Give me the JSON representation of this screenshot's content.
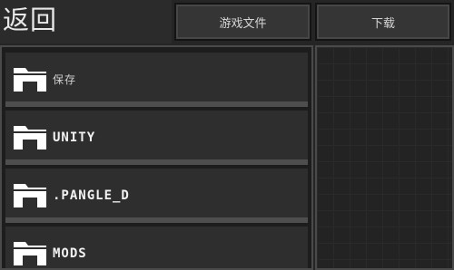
{
  "header": {
    "back_label": "返回",
    "tabs": [
      {
        "label": "游戏文件"
      },
      {
        "label": "下载"
      }
    ]
  },
  "folders": [
    {
      "label": "保存"
    },
    {
      "label": "UNITY"
    },
    {
      "label": ".PANGLE_D"
    },
    {
      "label": "MODS"
    }
  ],
  "icons": {
    "folder": "folder-icon"
  },
  "colors": {
    "background": "#252525",
    "row": "#2e2e2e",
    "row_separator": "#4e4e4e",
    "text": "#f2f2f2"
  }
}
